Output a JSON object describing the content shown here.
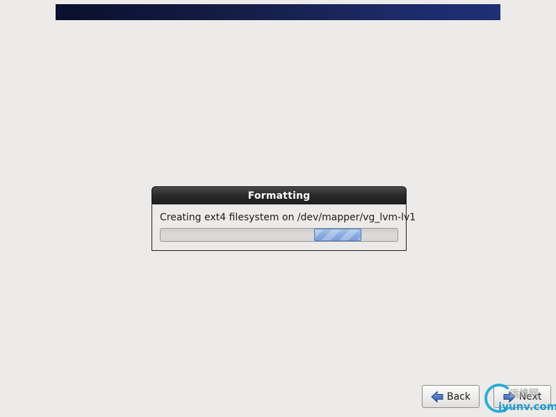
{
  "window": {
    "banner_color": "#141d45"
  },
  "dialog": {
    "title": "Formatting",
    "message": "Creating ext4 filesystem on /dev/mapper/vg_lvm-lv1",
    "progress": {
      "mode": "indeterminate",
      "accent": "#88abe0"
    }
  },
  "navigation": {
    "back_label": "Back",
    "back_icon": "arrow-left-icon",
    "next_label": "Next",
    "next_icon": "arrow-right-icon"
  },
  "watermark": {
    "cn_text": "运维网",
    "domain": "iyunv.com",
    "color": "#1a9bd7"
  }
}
